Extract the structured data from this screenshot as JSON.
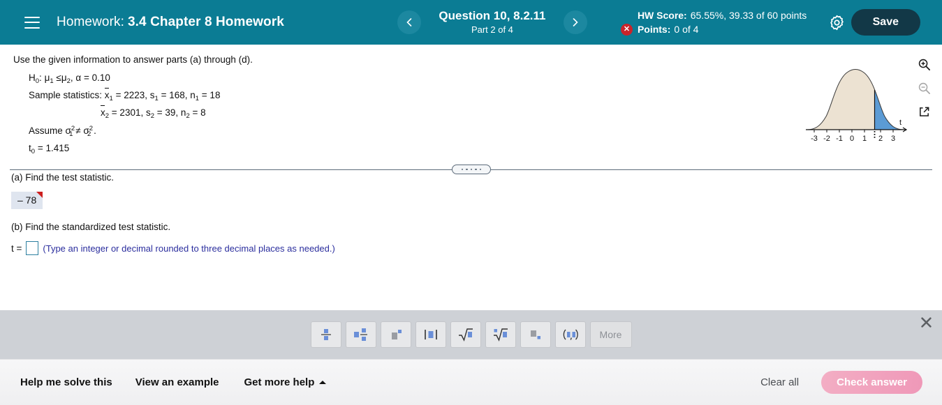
{
  "header": {
    "menu_icon": "hamburger-icon",
    "homework_label": "Homework:",
    "homework_name": "3.4 Chapter 8 Homework",
    "prev_icon": "chevron-left-icon",
    "next_icon": "chevron-right-icon",
    "question_title": "Question 10, 8.2.11",
    "question_part": "Part 2 of 4",
    "hw_score_label": "HW Score:",
    "hw_score_value": "65.55%, 39.33 of 60 points",
    "points_label": "Points:",
    "points_value": "0 of 4",
    "points_status_icon": "incorrect-x-icon",
    "gear_icon": "gear-icon",
    "save_label": "Save",
    "bg_color": "#0b7c94",
    "save_bg_color": "#123847",
    "status_color": "#c9242b"
  },
  "question": {
    "prompt": "Use the given information to answer parts (a) through (d).",
    "hypothesis": "H₀: μ₁ ≤ μ₂ , α = 0.10",
    "sample_line1": "Sample statistics: ẍ1 = 2223, s₁ = 168, n₁ = 18",
    "sample_line2": "ẍ2 = 2301, s₂ = 39, n₂ = 8",
    "assume": "Assume σ₁² ≠ σ₂² .",
    "t0": "t₀ = 1.415",
    "labels": {
      "h0": "H",
      "h0_sub": "0",
      "h0_rest": ": ",
      "mu": "μ",
      "mu1_sub": "1",
      "leq": "≤",
      "mu2_sub": "2",
      "alpha_eq": ", α = 0.10",
      "sample_prefix": "Sample statistics: ",
      "x": "x",
      "xs1": "1",
      "x1_eq": " = 2223, ",
      "s": "s",
      "s1_eq": " = 168, ",
      "n": "n",
      "n1_eq": " = 18",
      "xs2": "2",
      "x2_eq": " = 2301, ",
      "s2_eq": " = 39, ",
      "n2_eq": " = 8",
      "assume_prefix": "Assume ",
      "sigma": "σ",
      "sq": "2",
      "neq": " ≠ ",
      "period": " .",
      "t": "t",
      "t0sub": "0",
      "t0_eq": " = 1.415"
    }
  },
  "chart_data": {
    "type": "area",
    "title": "",
    "xlabel": "t",
    "ylabel": "",
    "xlim": [
      -3.6,
      3.9
    ],
    "tick_labels": [
      "-3",
      "-2",
      "-1",
      "0",
      "1",
      "2",
      "3"
    ],
    "tick_values": [
      -3,
      -2,
      -1,
      0,
      1,
      2,
      3
    ],
    "grid": false,
    "legend_position": "none",
    "curve": "t-distribution density",
    "critical_value": 1.415,
    "critical_line_style": "dotted",
    "shaded_region": "right tail from t = 1.415",
    "shade_fill_color": "#5b9bd5",
    "body_fill_color": "#ece2d2",
    "axis_color": "#111111",
    "axis_arrow_icon": "arrow-right-icon"
  },
  "right_tools": [
    {
      "name": "zoom-in-icon",
      "label": "Zoom in",
      "enabled": true
    },
    {
      "name": "zoom-out-icon",
      "label": "Zoom out",
      "enabled": false
    },
    {
      "name": "open-in-new-window-icon",
      "label": "Open in new window",
      "enabled": true
    }
  ],
  "divider": {
    "handle_icon": "drag-handle-dots",
    "dots": 5
  },
  "parts": {
    "a_text": "(a) Find the test statistic.",
    "a_answer": "– 78",
    "a_answer_flag": "incorrect-marker",
    "b_text": "(b) Find the standardized test statistic.",
    "b_prefix": "t =",
    "b_input_value": "",
    "b_input_placeholder": "",
    "b_hint": "(Type an integer or decimal rounded to three decimal places as needed.)",
    "hint_color": "#2b2e9e",
    "answer_bg_color": "#dfe5ef",
    "flag_color": "#cc1f1f"
  },
  "math_toolbar": {
    "bg_color": "#ced1d6",
    "close_icon": "close-x-icon",
    "buttons": [
      {
        "name": "fraction-icon",
        "label": "Fraction"
      },
      {
        "name": "mixed-number-icon",
        "label": "Mixed number"
      },
      {
        "name": "exponent-icon",
        "label": "Exponent"
      },
      {
        "name": "absolute-value-icon",
        "label": "Absolute value"
      },
      {
        "name": "square-root-icon",
        "label": "Square root"
      },
      {
        "name": "nth-root-icon",
        "label": "Nth root"
      },
      {
        "name": "subscript-icon",
        "label": "Subscript"
      },
      {
        "name": "ordered-pair-icon",
        "label": "Ordered pair"
      },
      {
        "name": "more-button",
        "label": "More"
      }
    ]
  },
  "footer": {
    "help_solve": "Help me solve this",
    "view_example": "View an example",
    "get_more_help": "Get more help",
    "get_more_help_icon": "caret-up-icon",
    "clear_all": "Clear all",
    "check_answer": "Check answer",
    "check_answer_enabled": false,
    "check_color": "#ef98b8"
  }
}
